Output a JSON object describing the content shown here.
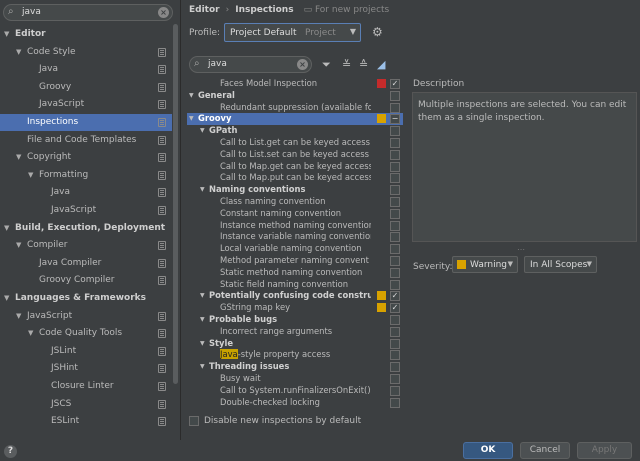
{
  "search": {
    "value": "java"
  },
  "sidebar": {
    "items": [
      {
        "label": "Editor",
        "depth": 0,
        "arrow": "▼",
        "bold": true,
        "selected": false,
        "copy": false
      },
      {
        "label": "Code Style",
        "depth": 1,
        "arrow": "▼",
        "bold": false,
        "selected": false,
        "copy": true
      },
      {
        "label": "Java",
        "depth": 2,
        "arrow": "",
        "bold": false,
        "selected": false,
        "copy": true
      },
      {
        "label": "Groovy",
        "depth": 2,
        "arrow": "",
        "bold": false,
        "selected": false,
        "copy": true
      },
      {
        "label": "JavaScript",
        "depth": 2,
        "arrow": "",
        "bold": false,
        "selected": false,
        "copy": true
      },
      {
        "label": "Inspections",
        "depth": 1,
        "arrow": "",
        "bold": false,
        "selected": true,
        "copy": true
      },
      {
        "label": "File and Code Templates",
        "depth": 1,
        "arrow": "",
        "bold": false,
        "selected": false,
        "copy": true
      },
      {
        "label": "Copyright",
        "depth": 1,
        "arrow": "▼",
        "bold": false,
        "selected": false,
        "copy": true
      },
      {
        "label": "Formatting",
        "depth": 2,
        "arrow": "▼",
        "bold": false,
        "selected": false,
        "copy": true
      },
      {
        "label": "Java",
        "depth": 3,
        "arrow": "",
        "bold": false,
        "selected": false,
        "copy": true
      },
      {
        "label": "JavaScript",
        "depth": 3,
        "arrow": "",
        "bold": false,
        "selected": false,
        "copy": true
      },
      {
        "label": "Build, Execution, Deployment",
        "depth": 0,
        "arrow": "▼",
        "bold": true,
        "selected": false,
        "copy": false
      },
      {
        "label": "Compiler",
        "depth": 1,
        "arrow": "▼",
        "bold": false,
        "selected": false,
        "copy": true
      },
      {
        "label": "Java Compiler",
        "depth": 2,
        "arrow": "",
        "bold": false,
        "selected": false,
        "copy": true
      },
      {
        "label": "Groovy Compiler",
        "depth": 2,
        "arrow": "",
        "bold": false,
        "selected": false,
        "copy": true
      },
      {
        "label": "Languages & Frameworks",
        "depth": 0,
        "arrow": "▼",
        "bold": true,
        "selected": false,
        "copy": false
      },
      {
        "label": "JavaScript",
        "depth": 1,
        "arrow": "▼",
        "bold": false,
        "selected": false,
        "copy": true
      },
      {
        "label": "Code Quality Tools",
        "depth": 2,
        "arrow": "▼",
        "bold": false,
        "selected": false,
        "copy": true
      },
      {
        "label": "JSLint",
        "depth": 3,
        "arrow": "",
        "bold": false,
        "selected": false,
        "copy": true
      },
      {
        "label": "JSHint",
        "depth": 3,
        "arrow": "",
        "bold": false,
        "selected": false,
        "copy": true
      },
      {
        "label": "Closure Linter",
        "depth": 3,
        "arrow": "",
        "bold": false,
        "selected": false,
        "copy": true
      },
      {
        "label": "JSCS",
        "depth": 3,
        "arrow": "",
        "bold": false,
        "selected": false,
        "copy": true
      },
      {
        "label": "ESLint",
        "depth": 3,
        "arrow": "",
        "bold": false,
        "selected": false,
        "copy": true
      }
    ]
  },
  "breadcrumb": {
    "part1": "Editor",
    "separator": "›",
    "part2": "Inspections",
    "project_note": "For new projects"
  },
  "profile": {
    "label": "Profile:",
    "value": "Project Default",
    "scope": "Project"
  },
  "inspections_search": {
    "value": "java"
  },
  "inspections": [
    {
      "label": "Faces Model Inspection",
      "depth": 2,
      "arrow": "",
      "bold": false,
      "selected": false,
      "severity": "#c42b2b",
      "checked": "✓"
    },
    {
      "label": "General",
      "depth": 0,
      "arrow": "▼",
      "bold": true,
      "selected": false,
      "severity": "",
      "checked": ""
    },
    {
      "label": "Redundant suppression (available for A",
      "depth": 2,
      "arrow": "",
      "bold": false,
      "selected": false,
      "severity": "",
      "checked": ""
    },
    {
      "label": "Groovy",
      "depth": 0,
      "arrow": "▼",
      "bold": true,
      "selected": true,
      "severity": "#d8a200",
      "checked": "−"
    },
    {
      "label": "GPath",
      "depth": 1,
      "arrow": "▼",
      "bold": true,
      "selected": false,
      "severity": "",
      "checked": ""
    },
    {
      "label": "Call to List.get can be keyed access",
      "depth": 2,
      "arrow": "",
      "bold": false,
      "selected": false,
      "severity": "",
      "checked": ""
    },
    {
      "label": "Call to List.set can be keyed access",
      "depth": 2,
      "arrow": "",
      "bold": false,
      "selected": false,
      "severity": "",
      "checked": ""
    },
    {
      "label": "Call to Map.get can be keyed access",
      "depth": 2,
      "arrow": "",
      "bold": false,
      "selected": false,
      "severity": "",
      "checked": ""
    },
    {
      "label": "Call to Map.put can be keyed access",
      "depth": 2,
      "arrow": "",
      "bold": false,
      "selected": false,
      "severity": "",
      "checked": ""
    },
    {
      "label": "Naming conventions",
      "depth": 1,
      "arrow": "▼",
      "bold": true,
      "selected": false,
      "severity": "",
      "checked": ""
    },
    {
      "label": "Class naming convention",
      "depth": 2,
      "arrow": "",
      "bold": false,
      "selected": false,
      "severity": "",
      "checked": ""
    },
    {
      "label": "Constant naming convention",
      "depth": 2,
      "arrow": "",
      "bold": false,
      "selected": false,
      "severity": "",
      "checked": ""
    },
    {
      "label": "Instance method naming convention",
      "depth": 2,
      "arrow": "",
      "bold": false,
      "selected": false,
      "severity": "",
      "checked": ""
    },
    {
      "label": "Instance variable naming convention",
      "depth": 2,
      "arrow": "",
      "bold": false,
      "selected": false,
      "severity": "",
      "checked": ""
    },
    {
      "label": "Local variable naming convention",
      "depth": 2,
      "arrow": "",
      "bold": false,
      "selected": false,
      "severity": "",
      "checked": ""
    },
    {
      "label": "Method parameter naming convent",
      "depth": 2,
      "arrow": "",
      "bold": false,
      "selected": false,
      "severity": "",
      "checked": ""
    },
    {
      "label": "Static method naming convention",
      "depth": 2,
      "arrow": "",
      "bold": false,
      "selected": false,
      "severity": "",
      "checked": ""
    },
    {
      "label": "Static field naming convention",
      "depth": 2,
      "arrow": "",
      "bold": false,
      "selected": false,
      "severity": "",
      "checked": ""
    },
    {
      "label": "Potentially confusing code constructs",
      "depth": 1,
      "arrow": "▼",
      "bold": true,
      "selected": false,
      "severity": "#d8a200",
      "checked": "✓"
    },
    {
      "label": "GString map key",
      "depth": 2,
      "arrow": "",
      "bold": false,
      "selected": false,
      "severity": "#d8a200",
      "checked": "✓"
    },
    {
      "label": "Probable bugs",
      "depth": 1,
      "arrow": "▼",
      "bold": true,
      "selected": false,
      "severity": "",
      "checked": ""
    },
    {
      "label": "Incorrect range arguments",
      "depth": 2,
      "arrow": "",
      "bold": false,
      "selected": false,
      "severity": "",
      "checked": ""
    },
    {
      "label": "Style",
      "depth": 1,
      "arrow": "▼",
      "bold": true,
      "selected": false,
      "severity": "",
      "checked": ""
    },
    {
      "label": "-style property access",
      "highlight": "Java",
      "depth": 2,
      "arrow": "",
      "bold": false,
      "selected": false,
      "severity": "",
      "checked": ""
    },
    {
      "label": "Threading issues",
      "depth": 1,
      "arrow": "▼",
      "bold": true,
      "selected": false,
      "severity": "",
      "checked": ""
    },
    {
      "label": "Busy wait",
      "depth": 2,
      "arrow": "",
      "bold": false,
      "selected": false,
      "severity": "",
      "checked": ""
    },
    {
      "label": "Call to System.runFinalizersOnExit()",
      "depth": 2,
      "arrow": "",
      "bold": false,
      "selected": false,
      "severity": "",
      "checked": ""
    },
    {
      "label": "Double-checked locking",
      "depth": 2,
      "arrow": "",
      "bold": false,
      "selected": false,
      "severity": "",
      "checked": ""
    }
  ],
  "bottom_checkbox_label": "Disable new inspections by default",
  "description": {
    "label": "Description",
    "text": "Multiple inspections are selected. You can edit them as a single inspection."
  },
  "severity": {
    "label": "Severity:",
    "value": "Warning",
    "color": "#d8a200"
  },
  "scope": {
    "value": "In All Scopes"
  },
  "buttons": {
    "ok": "OK",
    "cancel": "Cancel",
    "apply": "Apply",
    "help": "?"
  }
}
